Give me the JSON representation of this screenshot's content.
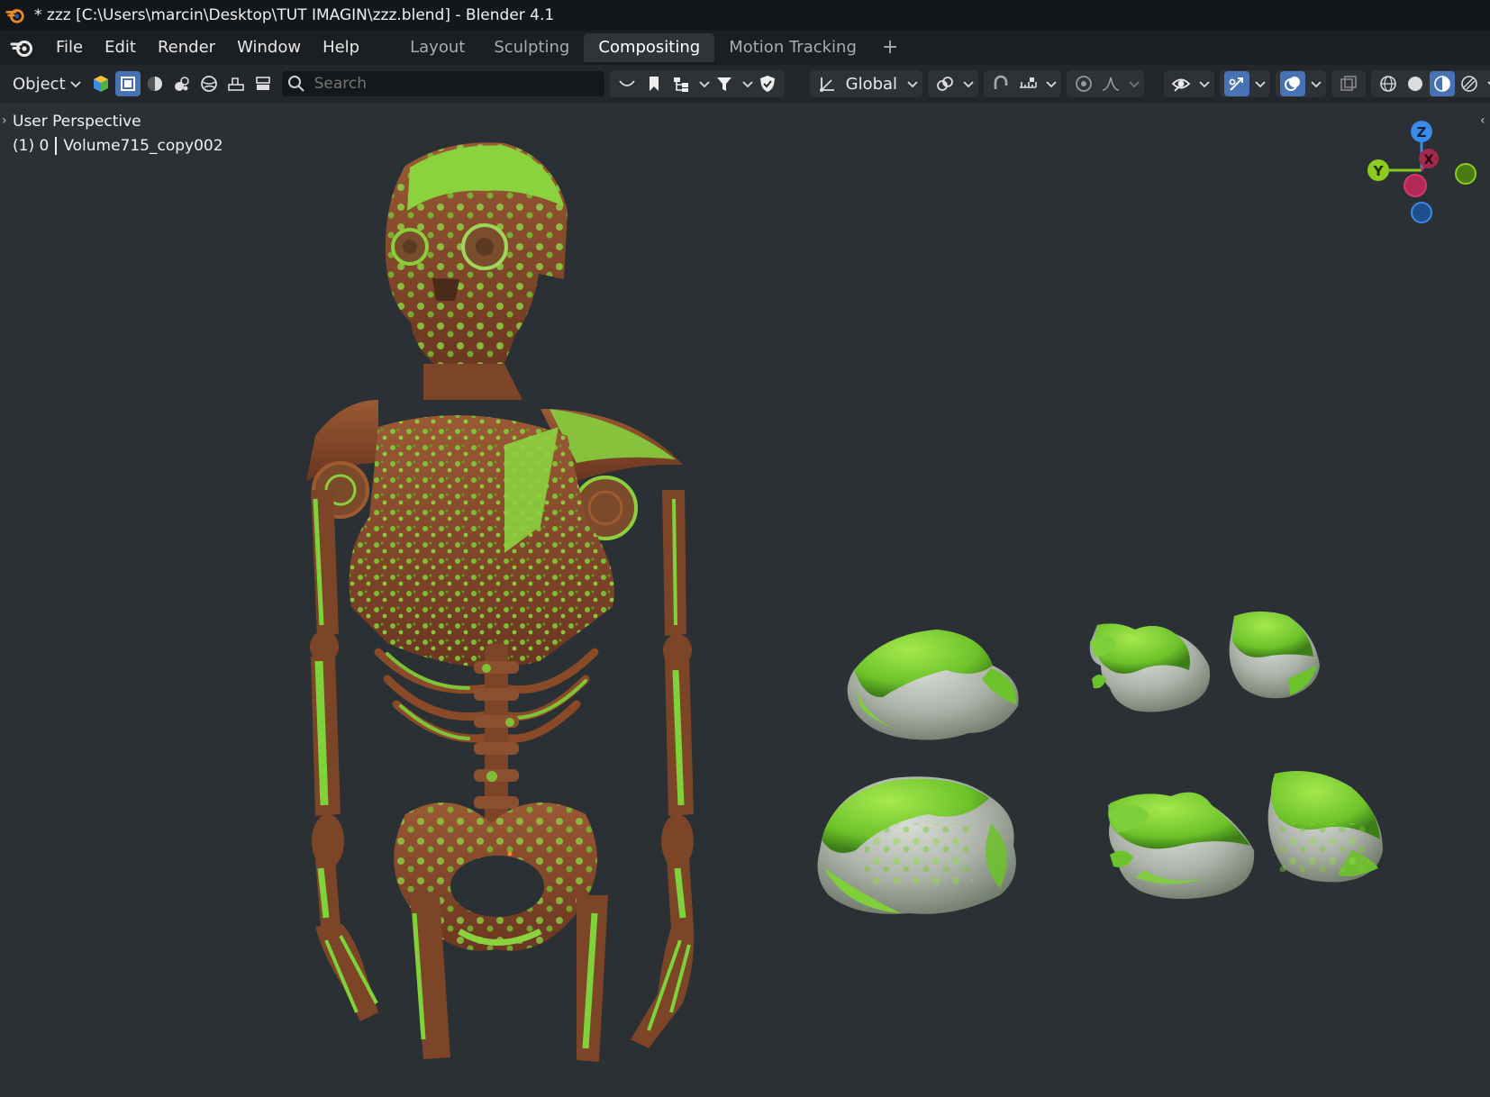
{
  "window": {
    "title": "* zzz [C:\\Users\\marcin\\Desktop\\TUT IMAGIN\\zzz.blend] - Blender 4.1"
  },
  "menu": {
    "items": [
      "File",
      "Edit",
      "Render",
      "Window",
      "Help"
    ]
  },
  "workspace_tabs": [
    {
      "label": "Layout",
      "active": false
    },
    {
      "label": "Sculpting",
      "active": false
    },
    {
      "label": "Compositing",
      "active": true
    },
    {
      "label": "Motion Tracking",
      "active": false
    }
  ],
  "toolbar": {
    "mode": "Object",
    "search_placeholder": "Search",
    "orientation": "Global"
  },
  "viewport": {
    "view_name": "User Perspective",
    "frame": "(1) 0",
    "active_object": "Volume715_copy002"
  },
  "gizmo": {
    "z_label": "Z",
    "y_label": "Y",
    "x_label": "X",
    "colors": {
      "z": "#3b8be8",
      "y": "#8ccc1c",
      "x": "#c8305a"
    }
  },
  "colors": {
    "accent": "#4772b3",
    "viewport_bg": "#2a3033",
    "moss": "#7fcf3a",
    "rust": "#8a4a2a",
    "rock": "#b9bdb8"
  },
  "icons": [
    "blender-logo-icon",
    "object-mode-icon",
    "select-box-icon",
    "wireframe-icon",
    "solid-icon",
    "material-icon",
    "rendered-icon",
    "search-icon",
    "filter-icon",
    "transform-orientation-icon",
    "pivot-icon",
    "snap-icon",
    "proportional-icon",
    "visibility-icon",
    "gizmo-icon",
    "overlay-icon",
    "xray-icon",
    "shading-icon"
  ]
}
